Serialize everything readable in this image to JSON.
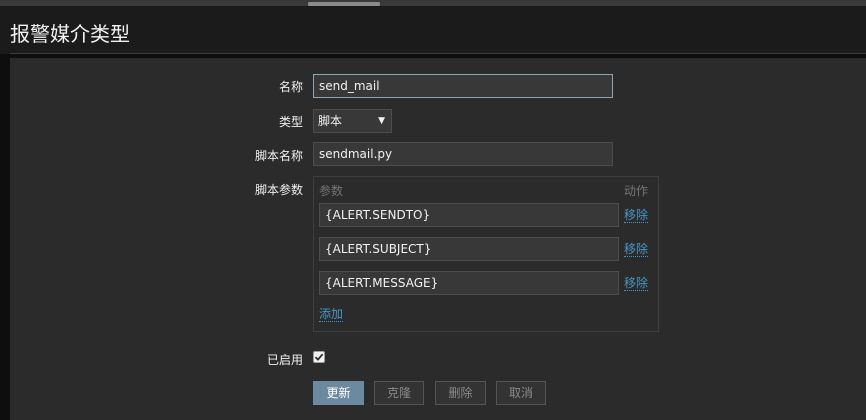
{
  "page": {
    "title": "报警媒介类型"
  },
  "form": {
    "name_label": "名称",
    "name_value": "send_mail",
    "type_label": "类型",
    "type_value": "脚本",
    "script_name_label": "脚本名称",
    "script_name_value": "sendmail.py",
    "script_params_label": "脚本参数",
    "params_header": "参数",
    "actions_header": "动作",
    "params": [
      {
        "value": "{ALERT.SENDTO}",
        "remove_label": "移除"
      },
      {
        "value": "{ALERT.SUBJECT}",
        "remove_label": "移除"
      },
      {
        "value": "{ALERT.MESSAGE}",
        "remove_label": "移除"
      }
    ],
    "add_label": "添加",
    "enabled_label": "已启用",
    "enabled_checked": true
  },
  "buttons": {
    "update": "更新",
    "clone": "克隆",
    "delete": "删除",
    "cancel": "取消"
  },
  "colors": {
    "link": "#4796c4",
    "primary_button": "#6b8aa0",
    "panel": "#2b2b2b"
  }
}
